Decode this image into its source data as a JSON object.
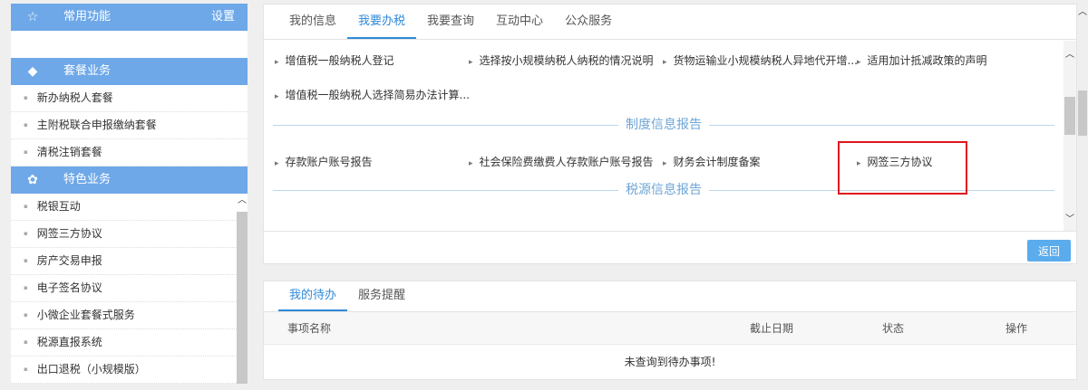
{
  "sidebar": {
    "favorites": {
      "title": "常用功能",
      "settings": "设置",
      "icon": "star-icon"
    },
    "packages": {
      "title": "套餐业务",
      "icon": "layers-icon",
      "items": [
        "新办纳税人套餐",
        "主附税联合申报缴纳套餐",
        "清税注销套餐"
      ]
    },
    "special": {
      "title": "特色业务",
      "icon": "clover-icon",
      "items": [
        "税银互动",
        "网签三方协议",
        "房产交易申报",
        "电子签名协议",
        "小微企业套餐式服务",
        "税源直报系统",
        "出口退税（小规模版）"
      ]
    }
  },
  "main": {
    "tabs": [
      "我的信息",
      "我要办税",
      "我要查询",
      "互动中心",
      "公众服务"
    ],
    "active_tab": 1,
    "row1": [
      "增值税一般纳税人登记",
      "选择按小规模纳税人纳税的情况说明",
      "货物运输业小规模纳税人异地代开增...",
      "适用加计抵减政策的声明"
    ],
    "row2": [
      "增值税一般纳税人选择简易办法计算..."
    ],
    "section1": "制度信息报告",
    "row3": [
      "存款账户账号报告",
      "社会保险费缴费人存款账户账号报告",
      "财务会计制度备案",
      "网签三方协议"
    ],
    "section2": "税源信息报告",
    "back": "返回"
  },
  "todo": {
    "tabs": [
      "我的待办",
      "服务提醒"
    ],
    "columns": [
      "事项名称",
      "截止日期",
      "状态",
      "操作"
    ],
    "empty": "未查询到待办事项!"
  },
  "colors": {
    "accent": "#2f8ad8",
    "header": "#6ea8e8",
    "highlight": "#e0161d"
  }
}
